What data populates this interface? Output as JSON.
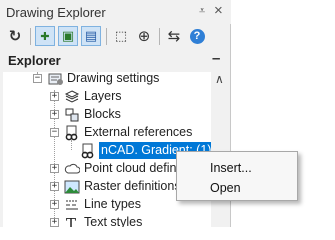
{
  "window": {
    "title": "Drawing Explorer",
    "pin_glyph": "⩡",
    "close_glyph": "×"
  },
  "toolbar": {
    "buttons": [
      {
        "name": "refresh-icon",
        "glyph": "↻",
        "active": false
      },
      {
        "name": "add-item-icon",
        "glyph": "✚",
        "active": true
      },
      {
        "name": "add-sub-item-icon",
        "glyph": "▣",
        "active": true
      },
      {
        "name": "add-alt-item-icon",
        "glyph": "▤",
        "active": true
      },
      {
        "name": "select-icon",
        "glyph": "⬚",
        "active": false
      },
      {
        "name": "zoom-icon",
        "glyph": "⊕",
        "active": false
      },
      {
        "name": "swap-icon",
        "glyph": "⇆",
        "active": false
      },
      {
        "name": "help-icon",
        "glyph": "?",
        "active": false
      }
    ]
  },
  "explorer": {
    "label": "Explorer",
    "collapse_glyph": "–"
  },
  "tree": {
    "root_label": "Drawing settings",
    "items": [
      {
        "label": "Layers",
        "icon": "layers-icon"
      },
      {
        "label": "Blocks",
        "icon": "blocks-icon"
      },
      {
        "label": "External references",
        "icon": "external-references-icon"
      },
      {
        "label": "nCAD. Gradient: (1)",
        "icon": "xref-item-icon",
        "selected": true
      },
      {
        "label": "Point cloud defin",
        "icon": "point-cloud-icon"
      },
      {
        "label": "Raster definitions",
        "icon": "raster-icon"
      },
      {
        "label": "Line types",
        "icon": "line-types-icon"
      },
      {
        "label": "Text styles",
        "icon": "text-styles-icon"
      }
    ]
  },
  "scrollbar": {
    "up_glyph": "∧"
  },
  "context_menu": {
    "items": [
      "Insert...",
      "Open"
    ]
  }
}
